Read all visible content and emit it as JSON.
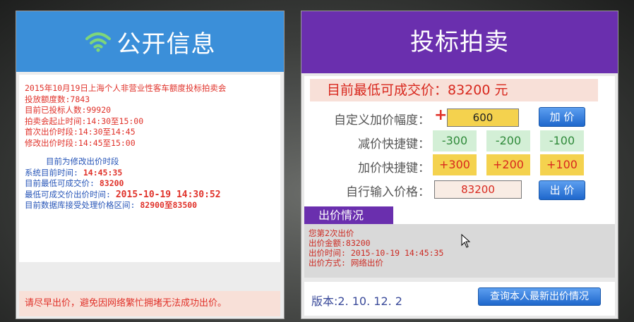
{
  "top_banner": "",
  "left_panel": {
    "title": "公开信息",
    "info_lines": [
      "2015年10月19日上海个人非营业性客车额度投标拍卖会",
      "投放额度数:7843",
      "目前已投标人数:99920",
      "拍卖会起止时间:14:30至15:00",
      "首次出价时段:14:30至14:45",
      "修改出价时段:14:45至15:00"
    ],
    "stage_line": "目前为修改出价时段",
    "system_time_label": "系统目前时间: ",
    "system_time_value": "14:45:35",
    "min_price_label": "目前最低可成交价: ",
    "min_price_value": "83200",
    "min_price_time_label": "最低可成交价出价时间: ",
    "min_price_time_value": "2015-10-19 14:30:52",
    "range_label": "目前数据库接受处理价格区间: ",
    "range_value": "82900至83500",
    "footer": "请尽早出价，避免因网络繁忙拥堵无法成功出价。"
  },
  "right_panel": {
    "title": "投标拍卖",
    "min_price_banner": "目前最低可成交价：83200 元",
    "custom_increment_label": "自定义加价幅度：",
    "plus_sign": "+",
    "custom_increment_value": "600",
    "add_price_button": "加 价",
    "decrease_label": "减价快捷键：",
    "decrease_options": [
      "-300",
      "-200",
      "-100"
    ],
    "increase_label": "加价快捷键：",
    "increase_options": [
      "+300",
      "+200",
      "+100"
    ],
    "manual_price_label": "自行输入价格：",
    "manual_price_value": "83200",
    "bid_button": "出 价",
    "bid_status_title": "出价情况",
    "bid_status_lines": [
      "您第2次出价",
      "出价金额:83200",
      "出价时间: 2015-10-19 14:45:35",
      "出价方式: 网络出价"
    ],
    "version": "版本:2. 10. 12. 2",
    "query_button": "查询本人最新出价情况"
  },
  "colors": {
    "left_header": "#3b8fd9",
    "right_header": "#6a2fae",
    "accent_red": "#e0322a",
    "info_blue": "#2856b8"
  },
  "icons": {
    "wifi": "wifi-icon",
    "cursor": "mouse-cursor-icon"
  }
}
